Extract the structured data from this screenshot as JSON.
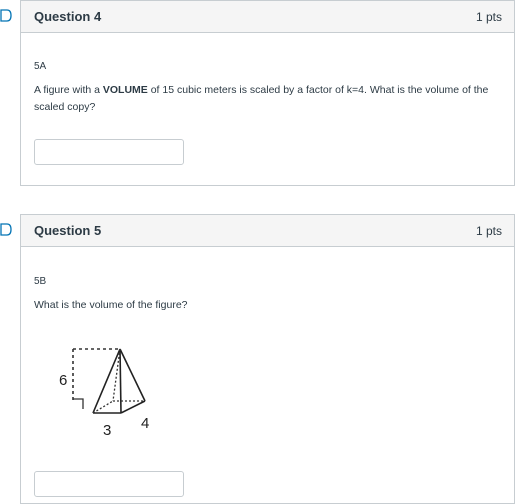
{
  "questions": [
    {
      "title": "Question 4",
      "points": "1 pts",
      "label": "5A",
      "text_pre": "A figure with a ",
      "text_bold": "VOLUME",
      "text_post": " of 15 cubic meters is scaled by a factor of k=4. What is the volume of the scaled copy?",
      "answer_value": ""
    },
    {
      "title": "Question 5",
      "points": "1 pts",
      "label": "5B",
      "text": "What is the volume of the figure?",
      "figure_labels": {
        "height": "6",
        "width": "3",
        "depth": "4"
      },
      "answer_value": ""
    }
  ],
  "colors": {
    "accent": "#0374b5",
    "border": "#c7cdd1",
    "header_bg": "#f5f5f5",
    "text": "#2d3b45"
  },
  "icons": [
    "flag-question-icon",
    "flag-question-icon"
  ]
}
